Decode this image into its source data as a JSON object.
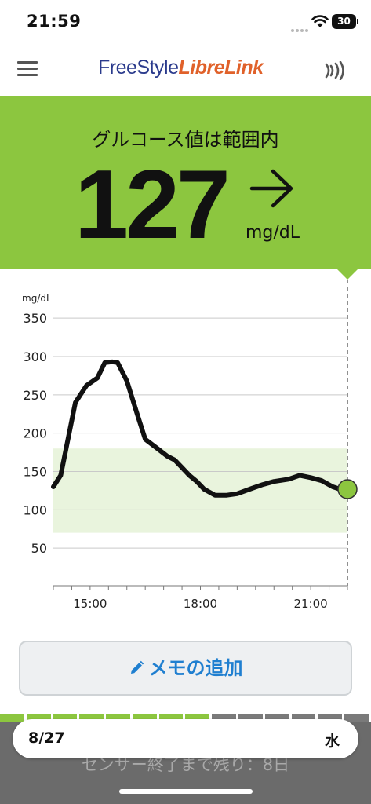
{
  "status_bar": {
    "time": "21:59",
    "battery": "30"
  },
  "header": {
    "logo_part1": "FreeStyle",
    "logo_part2": "LibreLink"
  },
  "reading": {
    "status": "グルコース値は範囲内",
    "value": "127",
    "unit": "mg/dL",
    "trend": "steady-arrow-right",
    "color": "#8cc63f"
  },
  "chart_data": {
    "type": "line",
    "ylabel": "mg/dL",
    "ylim": [
      0,
      350
    ],
    "y_ticks": [
      "350",
      "300",
      "250",
      "200",
      "150",
      "100",
      "50"
    ],
    "x_ticks": [
      "15:00",
      "18:00",
      "21:00"
    ],
    "target_range": [
      70,
      180
    ],
    "target_color": "#e9f4dd",
    "line_color": "#111111",
    "current_point_color": "#8cc63f",
    "x_range_hours": [
      14.0,
      22.0
    ],
    "x": [
      14.0,
      14.2,
      14.6,
      14.9,
      15.2,
      15.4,
      15.6,
      15.75,
      16.0,
      16.3,
      16.5,
      16.8,
      17.1,
      17.3,
      17.5,
      17.7,
      17.9,
      18.1,
      18.4,
      18.7,
      19.0,
      19.4,
      19.7,
      20.0,
      20.4,
      20.7,
      21.0,
      21.3,
      21.6,
      21.8,
      22.0
    ],
    "values": [
      130,
      145,
      240,
      262,
      272,
      292,
      293,
      292,
      268,
      222,
      192,
      181,
      170,
      165,
      155,
      145,
      137,
      127,
      119,
      119,
      121,
      128,
      133,
      137,
      140,
      145,
      142,
      138,
      130,
      127,
      127
    ]
  },
  "memo_button": {
    "label": "メモの追加"
  },
  "bottom": {
    "date": "8/27",
    "weekday": "水",
    "sensor_remaining": "センサー終了まで残り：8日",
    "progress_fraction": 0.58,
    "active_color": "#8cc63f",
    "inactive_color": "#7a7a7a"
  }
}
